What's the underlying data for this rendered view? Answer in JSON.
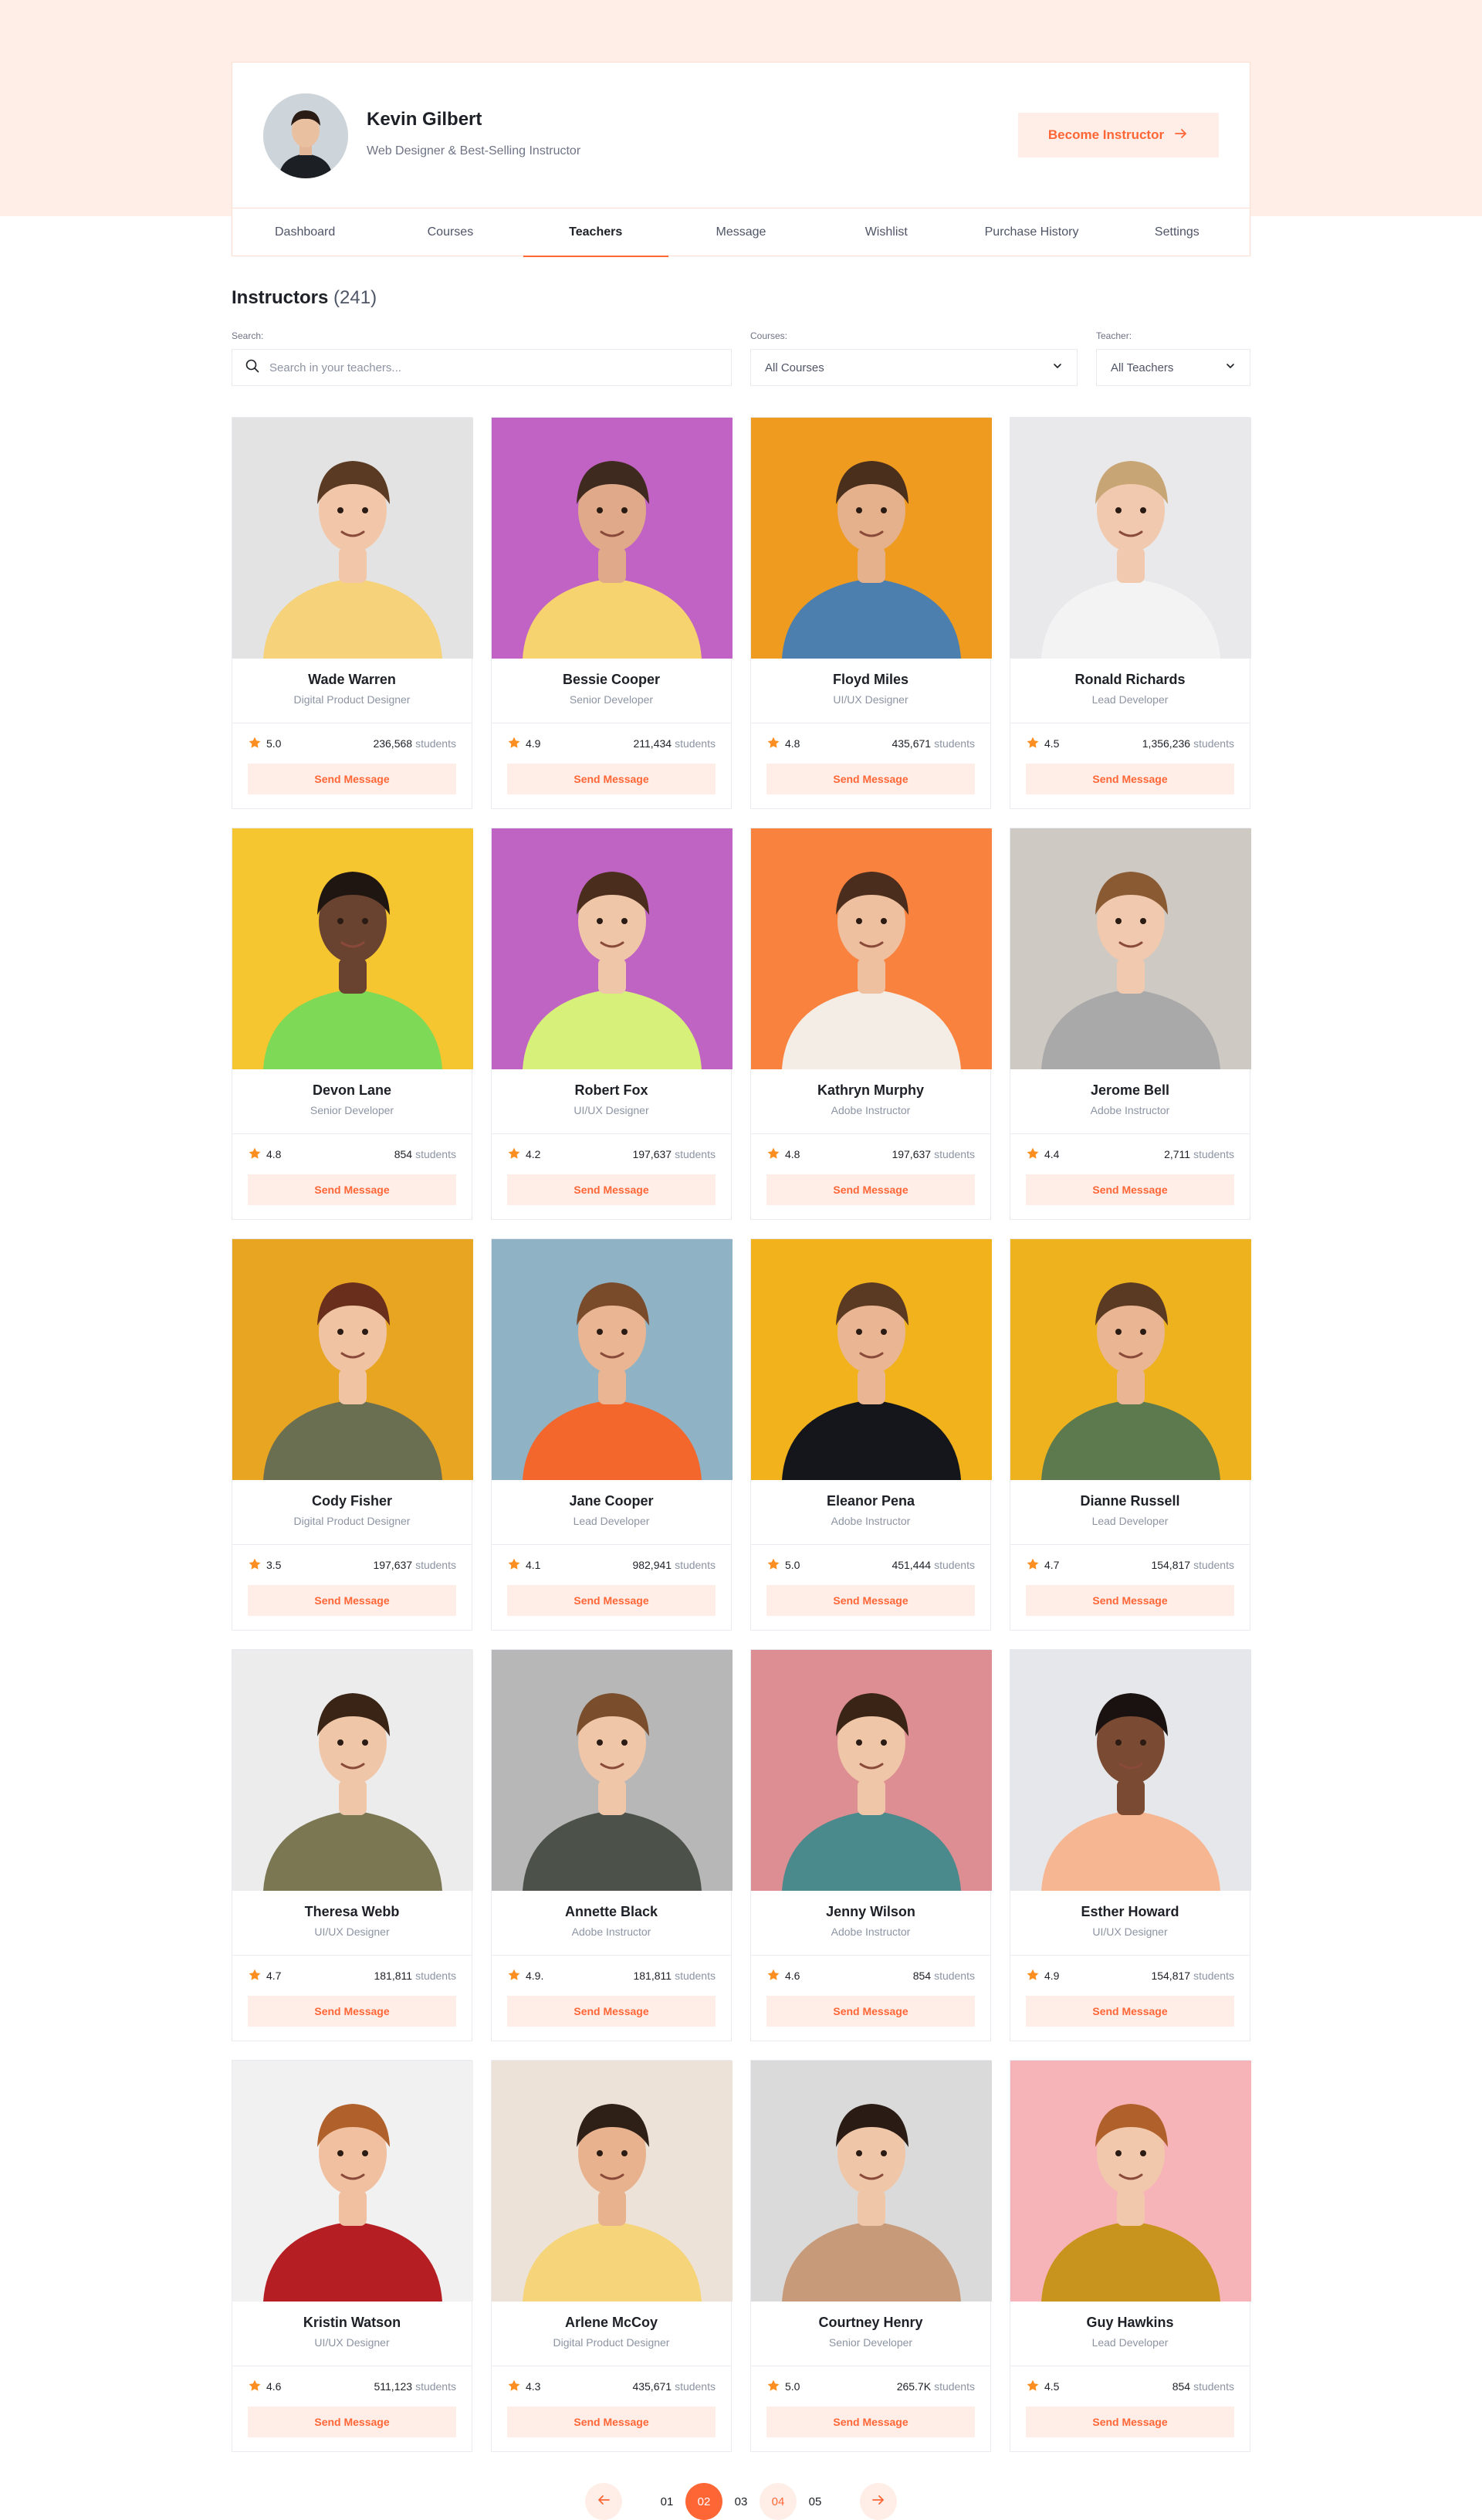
{
  "profile": {
    "name": "Kevin Gilbert",
    "subtitle": "Web Designer & Best-Selling Instructor",
    "become_label": "Become Instructor"
  },
  "tabs": [
    {
      "label": "Dashboard",
      "active": false
    },
    {
      "label": "Courses",
      "active": false
    },
    {
      "label": "Teachers",
      "active": true
    },
    {
      "label": "Message",
      "active": false
    },
    {
      "label": "Wishlist",
      "active": false
    },
    {
      "label": "Purchase History",
      "active": false
    },
    {
      "label": "Settings",
      "active": false
    }
  ],
  "section": {
    "title": "Instructors",
    "count": "(241)"
  },
  "filters": {
    "search_label": "Search:",
    "search_placeholder": "Search in your teachers...",
    "courses_label": "Courses:",
    "courses_value": "All Courses",
    "teacher_label": "Teacher:",
    "teacher_value": "All Teachers"
  },
  "students_label": "students",
  "send_label": "Send Message",
  "colors": {
    "accent": "#ff6636",
    "accent_soft": "#ffeee8",
    "star": "#fd8e1f"
  },
  "instructors": [
    {
      "name": "Wade Warren",
      "role": "Digital Product Designer",
      "rating": "5.0",
      "students": "236,568",
      "bg": "#e3e3e3",
      "shirt": "#f6d27a",
      "skin": "#f2c7a9",
      "hair": "#5a3a22"
    },
    {
      "name": "Bessie Cooper",
      "role": "Senior Developer",
      "rating": "4.9",
      "students": "211,434",
      "bg": "#c063c4",
      "shirt": "#f6d36e",
      "skin": "#e0a98a",
      "hair": "#3e2a1e"
    },
    {
      "name": "Floyd Miles",
      "role": "UI/UX Designer",
      "rating": "4.8",
      "students": "435,671",
      "bg": "#ef9b1f",
      "shirt": "#4d7fae",
      "skin": "#e5b08c",
      "hair": "#4a2f1d"
    },
    {
      "name": "Ronald Richards",
      "role": "Lead Developer",
      "rating": "4.5",
      "students": "1,356,236",
      "bg": "#e9e9eb",
      "shirt": "#f3f3f3",
      "skin": "#f0c9ae",
      "hair": "#c8a574"
    },
    {
      "name": "Devon Lane",
      "role": "Senior Developer",
      "rating": "4.8",
      "students": "854",
      "bg": "#f6c630",
      "shirt": "#7ed957",
      "skin": "#6a4330",
      "hair": "#1f1612"
    },
    {
      "name": "Robert Fox",
      "role": "UI/UX Designer",
      "rating": "4.2",
      "students": "197,637",
      "bg": "#c064c3",
      "shirt": "#d7f07a",
      "skin": "#f0c6a8",
      "hair": "#4a2d1c"
    },
    {
      "name": "Kathryn Murphy",
      "role": "Adobe Instructor",
      "rating": "4.8",
      "students": "197,637",
      "bg": "#f9823e",
      "shirt": "#f4ede6",
      "skin": "#efc0a0",
      "hair": "#4a2d1c"
    },
    {
      "name": "Jerome Bell",
      "role": "Adobe Instructor",
      "rating": "4.4",
      "students": "2,711",
      "bg": "#cfc9c3",
      "shirt": "#a9a9a9",
      "skin": "#f0c9ae",
      "hair": "#8a5a32"
    },
    {
      "name": "Cody Fisher",
      "role": "Digital Product Designer",
      "rating": "3.5",
      "students": "197,637",
      "bg": "#e8a521",
      "shirt": "#6b6f52",
      "skin": "#f0c3a3",
      "hair": "#6a2f1c"
    },
    {
      "name": "Jane Cooper",
      "role": "Lead Developer",
      "rating": "4.1",
      "students": "982,941",
      "bg": "#8fb2c4",
      "shirt": "#f3672c",
      "skin": "#e9b592",
      "hair": "#7a4b2a"
    },
    {
      "name": "Eleanor Pena",
      "role": "Adobe Instructor",
      "rating": "5.0",
      "students": "451,444",
      "bg": "#f2b21b",
      "shirt": "#14161c",
      "skin": "#e9b592",
      "hair": "#5a3a22"
    },
    {
      "name": "Dianne Russell",
      "role": "Lead Developer",
      "rating": "4.7",
      "students": "154,817",
      "bg": "#eeb21f",
      "shirt": "#5d7a4e",
      "skin": "#e9b592",
      "hair": "#5a3a22"
    },
    {
      "name": "Theresa Webb",
      "role": "UI/UX Designer",
      "rating": "4.7",
      "students": "181,811",
      "bg": "#ececec",
      "shirt": "#7a7752",
      "skin": "#f0c6a8",
      "hair": "#3a2416"
    },
    {
      "name": "Annette Black",
      "role": "Adobe Instructor",
      "rating": "4.9.",
      "students": "181,811",
      "bg": "#b7b7b7",
      "shirt": "#4c5249",
      "skin": "#f0c6a8",
      "hair": "#7a4e2c"
    },
    {
      "name": "Jenny Wilson",
      "role": "Adobe Instructor",
      "rating": "4.6",
      "students": "854",
      "bg": "#dd8e92",
      "shirt": "#4a8a8c",
      "skin": "#f0c6a8",
      "hair": "#3a2416"
    },
    {
      "name": "Esther Howard",
      "role": "UI/UX Designer",
      "rating": "4.9",
      "students": "154,817",
      "bg": "#e6e7ea",
      "shirt": "#f6b691",
      "skin": "#7a4a33",
      "hair": "#1a1210"
    },
    {
      "name": "Kristin Watson",
      "role": "UI/UX Designer",
      "rating": "4.6",
      "students": "511,123",
      "bg": "#f1f1f1",
      "shirt": "#b51f24",
      "skin": "#f0c0a0",
      "hair": "#b0602a"
    },
    {
      "name": "Arlene McCoy",
      "role": "Digital Product Designer",
      "rating": "4.3",
      "students": "435,671",
      "bg": "#ece2d7",
      "shirt": "#f6d47a",
      "skin": "#e8b28f",
      "hair": "#2e1f17"
    },
    {
      "name": "Courtney Henry",
      "role": "Senior Developer",
      "rating": "5.0",
      "students": "265.7K",
      "bg": "#dadada",
      "shirt": "#c79a7a",
      "skin": "#f0c6a8",
      "hair": "#2a1c14"
    },
    {
      "name": "Guy Hawkins",
      "role": "Lead Developer",
      "rating": "4.5",
      "students": "854",
      "bg": "#f6b4b8",
      "shirt": "#c8941d",
      "skin": "#f2c8ac",
      "hair": "#b0602a"
    }
  ],
  "pagination": {
    "pages": [
      {
        "label": "01",
        "state": "normal"
      },
      {
        "label": "02",
        "state": "active"
      },
      {
        "label": "03",
        "state": "normal"
      },
      {
        "label": "04",
        "state": "soft"
      },
      {
        "label": "05",
        "state": "normal"
      }
    ]
  }
}
